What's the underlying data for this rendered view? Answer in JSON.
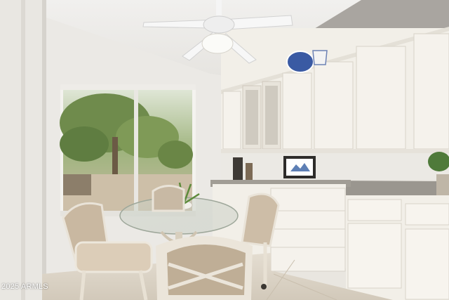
{
  "photo": {
    "subject": "breakfast-nook-with-kitchen-cabinets"
  },
  "watermark": {
    "text": "2025 ARMLS"
  },
  "colors": {
    "wall": "#ecebe6",
    "accent_wall": "#a8a49f",
    "cabinet": "#f2efe8",
    "countertop": "#9a968f",
    "floor": "#ddd6c9",
    "window_foliage": "#6f8b4c"
  }
}
